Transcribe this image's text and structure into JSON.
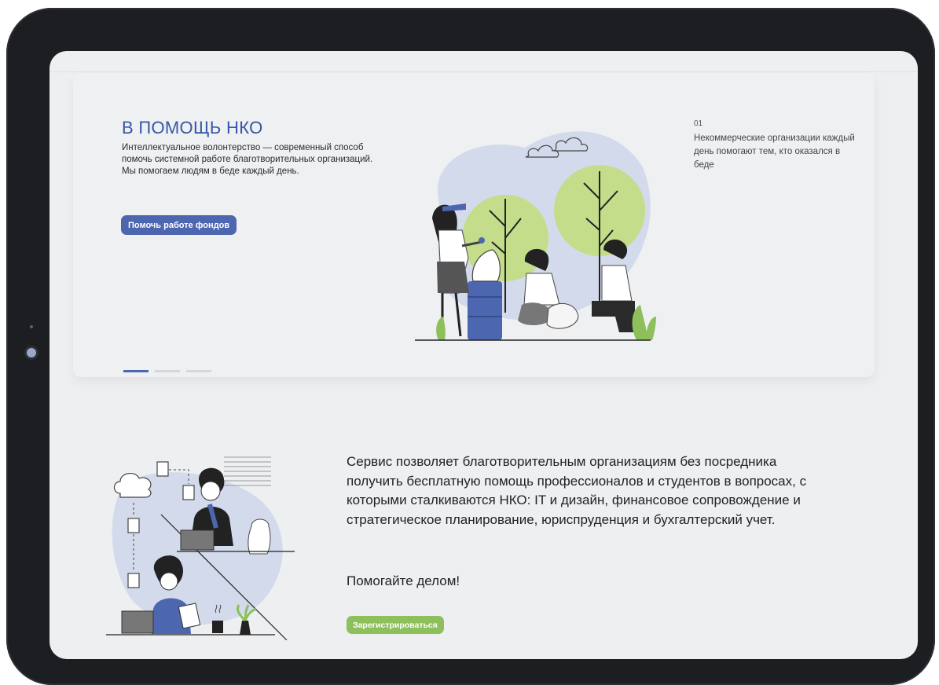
{
  "hero": {
    "title": "В ПОМОЩЬ НКО",
    "description": "Интеллектуальное волонтерство — современный способ помочь системной работе благотворительных организаций. Мы помогаем людям в беде каждый день.",
    "button_label": "Помочь работе фондов",
    "slide_number": "01",
    "slide_text": "Некоммерческие организации каждый день помогают тем, кто оказался в беде",
    "slides": {
      "total": 3,
      "active": 1
    }
  },
  "about": {
    "description": "Сервис позволяет благотворительным организациям без посредника получить бесплатную помощь профессионалов и студентов в вопросах, с которыми сталкиваются НКО: IT и дизайн, финансовое сопровождение и стратегическое планирование, юриспруденция и бухгалтерский учет.",
    "call_to_action": "Помогайте делом!",
    "register_label": "Зарегистрироваться"
  },
  "colors": {
    "primary": "#4d66b0",
    "title": "#3656a6",
    "accent_green": "#8dc05b",
    "screen_bg": "#edeff1",
    "device_frame": "#1c1e21"
  },
  "icons": [
    "camera-icon",
    "cloud-icon",
    "document-icon",
    "coffee-cup-icon",
    "plant-icon"
  ]
}
